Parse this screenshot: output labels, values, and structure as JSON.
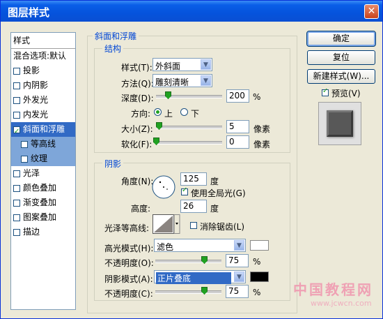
{
  "window": {
    "title": "图层样式",
    "close_glyph": "✕"
  },
  "sidebar": {
    "header": "样式",
    "blend": "混合选项:默认",
    "items": [
      {
        "label": "投影",
        "checked": false
      },
      {
        "label": "内阴影",
        "checked": false
      },
      {
        "label": "外发光",
        "checked": false
      },
      {
        "label": "内发光",
        "checked": false
      },
      {
        "label": "斜面和浮雕",
        "checked": true
      },
      {
        "label": "等高线",
        "checked": false
      },
      {
        "label": "纹理",
        "checked": false
      },
      {
        "label": "光泽",
        "checked": false
      },
      {
        "label": "颜色叠加",
        "checked": false
      },
      {
        "label": "渐变叠加",
        "checked": false
      },
      {
        "label": "图案叠加",
        "checked": false
      },
      {
        "label": "描边",
        "checked": false
      }
    ]
  },
  "bevel": {
    "title": "斜面和浮雕",
    "structure": {
      "title": "结构",
      "style_label": "样式(T):",
      "style_value": "外斜面",
      "technique_label": "方法(Q):",
      "technique_value": "雕刻清晰",
      "depth_label": "深度(D):",
      "depth_value": "200",
      "depth_unit": "%",
      "direction_label": "方向:",
      "dir_up": "上",
      "dir_down": "下",
      "size_label": "大小(Z):",
      "size_value": "5",
      "size_unit": "像素",
      "soften_label": "软化(F):",
      "soften_value": "0",
      "soften_unit": "像素"
    },
    "shading": {
      "title": "阴影",
      "angle_label": "角度(N):",
      "angle_value": "125",
      "angle_unit": "度",
      "global_light_label": "使用全局光(G)",
      "global_light_checked": true,
      "altitude_label": "高度:",
      "altitude_value": "26",
      "altitude_unit": "度",
      "gloss_label": "光泽等高线:",
      "antialias_label": "消除锯齿(L)",
      "antialias_checked": false,
      "highlight_mode_label": "高光模式(H):",
      "highlight_mode_value": "滤色",
      "highlight_color": "#ffffff",
      "highlight_opacity_label": "不透明度(O):",
      "highlight_opacity_value": "75",
      "shadow_mode_label": "阴影模式(A):",
      "shadow_mode_value": "正片叠底",
      "shadow_color": "#000000",
      "shadow_opacity_label": "不透明度(C):",
      "shadow_opacity_value": "75",
      "percent": "%"
    }
  },
  "buttons": {
    "ok": "确定",
    "reset": "复位",
    "new_style": "新建样式(W)...",
    "preview_label": "预览(V)",
    "preview_checked": true
  },
  "watermark": {
    "line1": "中国教程网",
    "line2": "www.jcwcn.com"
  }
}
